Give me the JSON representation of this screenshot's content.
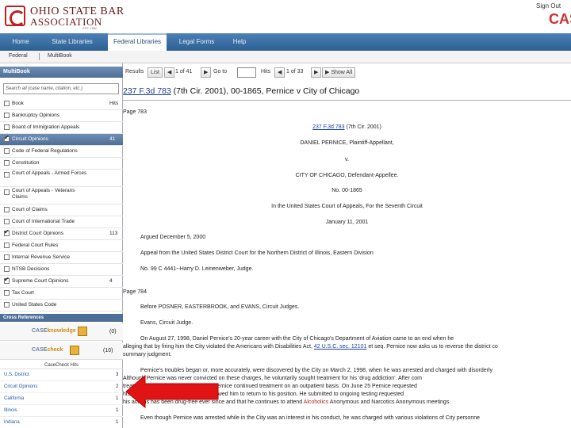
{
  "header": {
    "logo_line1": "OHIO STATE BAR",
    "logo_line2": "ASSOCIATION",
    "logo_est": "EST. 1880",
    "signout": "Sign Out",
    "brand_right": "CAS"
  },
  "nav": {
    "tabs": [
      {
        "label": "Home"
      },
      {
        "label": "State Libraries"
      },
      {
        "label": "Federal Libraries",
        "active": true
      },
      {
        "label": "Legal Forms"
      },
      {
        "label": "Help"
      }
    ]
  },
  "subnav": {
    "items": [
      "Federal",
      "MultiBook"
    ]
  },
  "sidebar": {
    "title": "MultiBook",
    "search_placeholder": "Search all (case name, citation, etc.)",
    "books": [
      {
        "label": "Book",
        "count": "Hits",
        "checked": false
      },
      {
        "label": "Bankruptcy Opinions",
        "count": "",
        "checked": false
      },
      {
        "label": "Board of Immigration Appeals",
        "count": "",
        "checked": false
      },
      {
        "label": "Circuit Opinions",
        "count": "41",
        "checked": true,
        "selected": true
      },
      {
        "label": "Code of Federal Regulations",
        "count": "",
        "checked": false
      },
      {
        "label": "Constitution",
        "count": "",
        "checked": false
      },
      {
        "label": "Court of Appeals - Armed Forces",
        "count": "",
        "checked": false,
        "wrap": true
      },
      {
        "label": "Court of Appeals - Veterans Claims",
        "count": "",
        "checked": false,
        "wrap": true
      },
      {
        "label": "Court of Claims",
        "count": "",
        "checked": false
      },
      {
        "label": "Court of International Trade",
        "count": "",
        "checked": false
      },
      {
        "label": "District Court Opinions",
        "count": "113",
        "checked": true
      },
      {
        "label": "Federal Court Rules",
        "count": "",
        "checked": false
      },
      {
        "label": "Internal Revenue Service",
        "count": "",
        "checked": false
      },
      {
        "label": "NTSB Decisions",
        "count": "",
        "checked": false
      },
      {
        "label": "Supreme Court Opinions",
        "count": "4",
        "checked": true
      },
      {
        "label": "Tax Court",
        "count": "",
        "checked": false
      },
      {
        "label": "United States Code",
        "count": "",
        "checked": false
      }
    ],
    "cross_refs_title": "Cross References",
    "caseknowledge": {
      "logo_a": "CASE",
      "logo_b": "knowledge",
      "count": "(0)"
    },
    "casecheck": {
      "logo_a": "CASE",
      "logo_b": "check",
      "count": "(10)"
    },
    "casecheck_results_label": "CaseCheck Hits",
    "casecheck_hits": [
      {
        "label": "U.S. District",
        "count": "3"
      },
      {
        "label": "Circuit Opinions",
        "count": "2"
      },
      {
        "label": "California",
        "count": "1"
      },
      {
        "label": "Illinois",
        "count": "1"
      },
      {
        "label": "Indiana",
        "count": "1"
      }
    ]
  },
  "results_bar": {
    "results_label": "Results",
    "list_btn": "List",
    "position": "1 of 41",
    "go_to_label": "Go to",
    "hits_label": "Hits",
    "hits_position": "1 of 33",
    "show_all_btn": "Show All"
  },
  "document": {
    "title_link": "237 F.3d 783",
    "title_rest": "(7th Cir. 2001), 00-1865, Pernice v City of Chicago",
    "page_783": "Page 783",
    "cite_link": "237 F.3d 783",
    "cite_rest": "(7th Cir. 2001)",
    "plaintiff": "DANIEL PERNICE, Plaintiff-Appellant,",
    "v": "v.",
    "defendant": "CITY OF CHICAGO, Defendant-Appellee.",
    "docket": "No. 00-1865",
    "court": "In the United States Court of Appeals, For the Seventh Circuit",
    "date": "January 11, 2001",
    "argued": "Argued December 5, 2000",
    "appeal": "Appeal from the United States District Court for the Northern District of Illinois, Eastern Division",
    "case_no": "No. 99 C 4441--Harry D. Leinenweber, Judge.",
    "page_784": "Page 784",
    "before": "Before POSNER, EASTERBROOK, and EVANS, Circuit Judges.",
    "author": "Evans, Circuit Judge.",
    "para1_a": "On August 27, 1998, Daniel Pernice's 20-year career with the City of Chicago's Department of Aviation came to an end when he",
    "para1_b": "alleging that by firing him the City violated the Americans with Disabilities Act,",
    "para1_link": "42 U.S.C. sec. 12101",
    "para1_c": "et seq. Pernice now asks us to reverse the district co",
    "para1_d": "summary judgment.",
    "para2_a": "Pernice's troubles began or, more accurately, were discovered by the City on March 2, 1998, when he was arrested and charged with disorderly",
    "para2_b": "Although Pernice was never convicted on these charges, he voluntarily sought treatment for his 'drug addiction'. After com",
    "para2_c": "treatment center in early June 1998, Pernice continued treatment on an outpatient basis. On June 25 Pernice requested",
    "para2_d": "his 'drug dependency'",
    "para2_e": "and the City allowed him to return to his position. He submitted to ongoing testing requested",
    "para2_f": "his actions has been drug-free ever since and that he continues to attend",
    "para2_hl": "Alcoholics",
    "para2_g": "Anonymous and Narcotics Anonymous meetings.",
    "para3": "Even though Pernice was arrested while in the City was an interest in his conduct, he was charged with various violations of City personne"
  }
}
